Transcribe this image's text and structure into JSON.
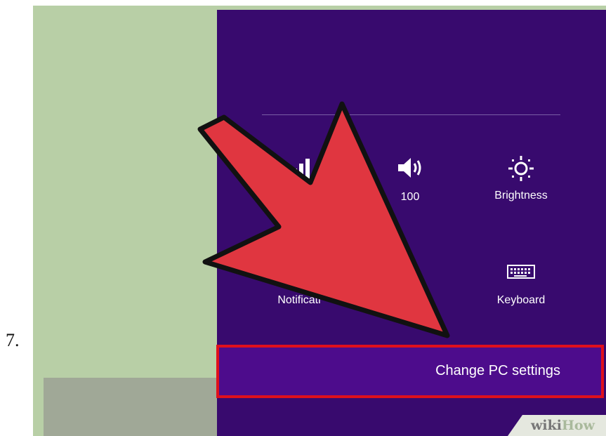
{
  "step": {
    "number": "7."
  },
  "settings_panel": {
    "tiles": [
      {
        "icon": "network-icon",
        "label": ""
      },
      {
        "icon": "volume-icon",
        "label": "100"
      },
      {
        "icon": "brightness-icon",
        "label": "Brightness"
      },
      {
        "icon": "notifications-icon",
        "label": "Notificati"
      },
      {
        "icon": "power-icon",
        "label": ""
      },
      {
        "icon": "keyboard-icon",
        "label": "Keyboard"
      }
    ],
    "change_pc_settings": "Change PC settings"
  },
  "highlight": {
    "border_color": "#e0101c"
  },
  "pointer_arrow": {
    "color": "#e03640",
    "outline_color": "#111111"
  },
  "watermark": {
    "part1": "wiki",
    "part2": "How"
  },
  "colors": {
    "panel": "#380a6e",
    "background": "#b8cfa6"
  }
}
